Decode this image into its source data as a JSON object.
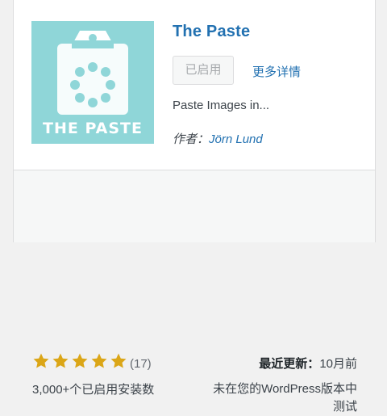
{
  "plugin": {
    "name": "The Paste",
    "icon_text": "THE PASTE",
    "icon_bg": "#8fd6d8",
    "action_button": "已启用",
    "more_details": "更多详情",
    "description": "Paste Images in...",
    "author_label": "作者：",
    "author_name": "Jörn Lund"
  },
  "footer": {
    "rating": {
      "stars": 5,
      "max": 5,
      "count": "(17)",
      "star_color": "#dba617"
    },
    "installs": "3,000+个已启用安装数",
    "last_updated_label": "最近更新：",
    "last_updated_value": "10月前",
    "compatibility": "未在您的WordPress版本中测试"
  }
}
